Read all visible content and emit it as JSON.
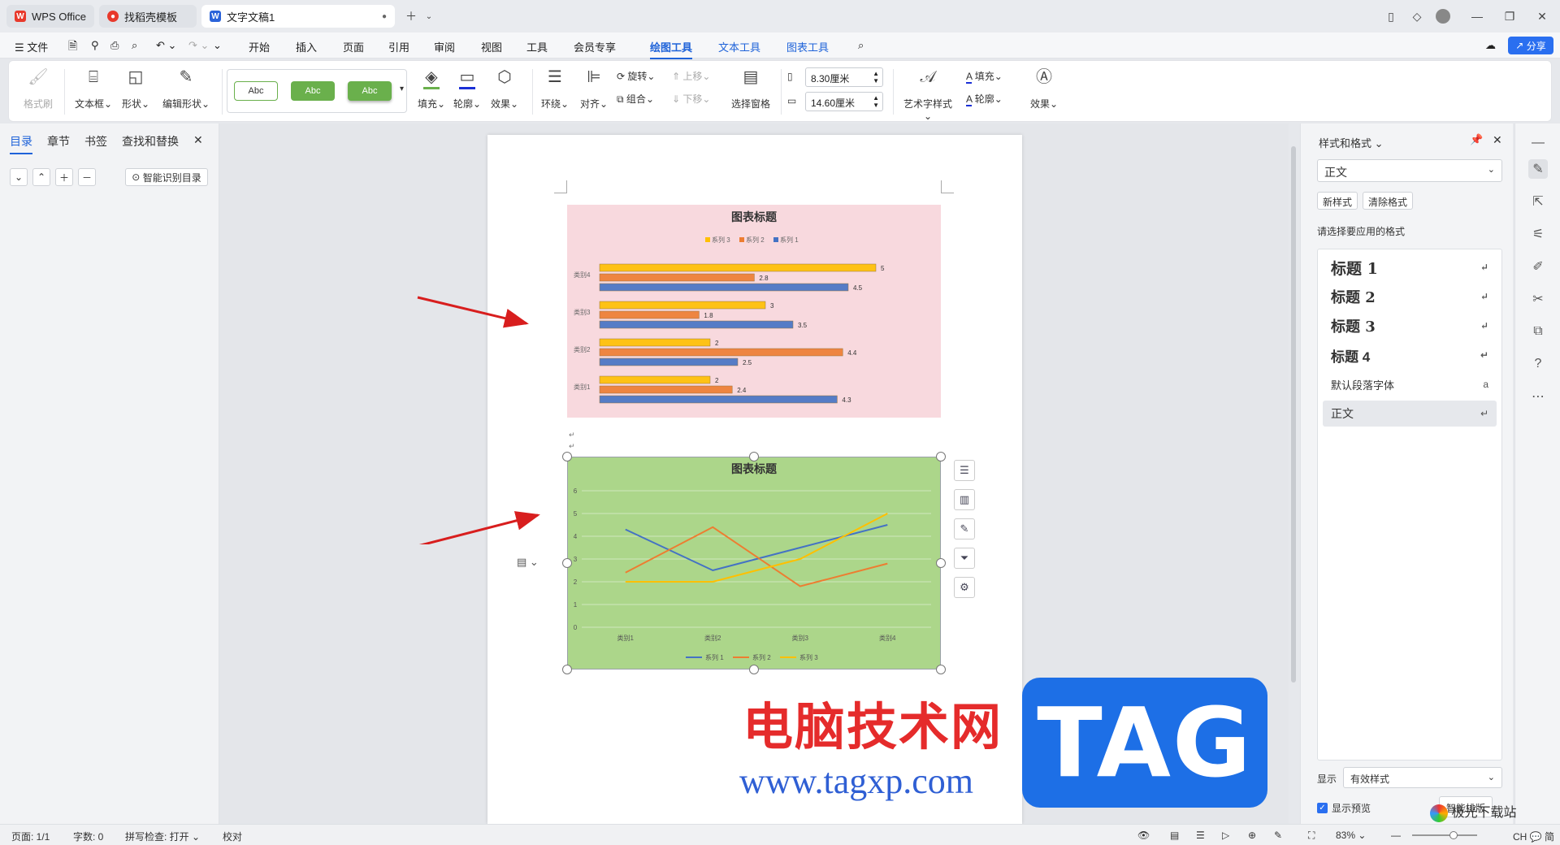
{
  "tabs": [
    {
      "label": "WPS Office",
      "icon": "wps-logo-icon"
    },
    {
      "label": "找稻壳模板",
      "icon": "daoke-icon"
    },
    {
      "label": "文字文稿1",
      "icon": "word-doc-icon"
    }
  ],
  "menu": {
    "file": "文件",
    "items": [
      "开始",
      "插入",
      "页面",
      "引用",
      "审阅",
      "视图",
      "工具",
      "会员专享"
    ],
    "contextual": [
      "绘图工具",
      "文本工具",
      "图表工具"
    ],
    "share": "分享"
  },
  "ribbon": {
    "format_painter": "格式刷",
    "textbox": "文本框",
    "shape": "形状",
    "edit_shape": "编辑形状",
    "style_abc": [
      "Abc",
      "Abc",
      "Abc"
    ],
    "fill": "填充",
    "outline": "轮廓",
    "effect": "效果",
    "wrap": "环绕",
    "align": "对齐",
    "rotate": "旋转",
    "group": "组合",
    "bring_up": "上移",
    "send_down": "下移",
    "selection_pane": "选择窗格",
    "height": "8.30厘米",
    "width": "14.60厘米",
    "art_style": "艺术字样式",
    "text_fill": "填充",
    "text_outline": "轮廓",
    "text_effect": "效果"
  },
  "left_panel": {
    "tabs": [
      "目录",
      "章节",
      "书签",
      "查找和替换"
    ],
    "smart_toc": "智能识别目录"
  },
  "right_panel": {
    "title": "样式和格式",
    "current_style": "正文",
    "new_style": "新样式",
    "clear_format": "清除格式",
    "prompt": "请选择要应用的格式",
    "styles": [
      "标题 1",
      "标题 2",
      "标题 3",
      "标题 4",
      "默认段落字体",
      "正文"
    ],
    "show_label": "显示",
    "show_value": "有效样式",
    "preview_label": "显示预览",
    "smart_layout": "智能排版"
  },
  "status": {
    "page": "页面: 1/1",
    "words": "字数: 0",
    "spell": "拼写检查: 打开",
    "proof": "校对",
    "zoom": "83%",
    "ime": "CH 💬 简"
  },
  "watermark": {
    "site_cn": "电脑技术网",
    "url": "www.tagxp.com",
    "tag": "TAG",
    "corner": "极光下载站"
  },
  "chart_data": [
    {
      "type": "bar",
      "title": "图表标题",
      "categories": [
        "类别1",
        "类别2",
        "类别3",
        "类别4"
      ],
      "series": [
        {
          "name": "系列 1",
          "values": [
            4.3,
            2.5,
            3.5,
            4.5
          ],
          "color": "#4472c4"
        },
        {
          "name": "系列 2",
          "values": [
            2.4,
            4.4,
            1.8,
            2.8
          ],
          "color": "#ed7d31"
        },
        {
          "name": "系列 3",
          "values": [
            2,
            2,
            3,
            5
          ],
          "color": "#ffc000"
        }
      ],
      "legend": [
        "系列 3",
        "系列 2",
        "系列 1"
      ],
      "background": "#f8d9de",
      "orientation": "horizontal"
    },
    {
      "type": "line",
      "title": "图表标题",
      "categories": [
        "类别1",
        "类别2",
        "类别3",
        "类别4"
      ],
      "ylim": [
        0,
        6
      ],
      "yticks": [
        "0",
        "1",
        "2",
        "3",
        "4",
        "5",
        "6"
      ],
      "series": [
        {
          "name": "系列 1",
          "values": [
            4.3,
            2.5,
            3.5,
            4.5
          ],
          "color": "#4472c4"
        },
        {
          "name": "系列 2",
          "values": [
            2.4,
            4.4,
            1.8,
            2.8
          ],
          "color": "#ed7d31"
        },
        {
          "name": "系列 3",
          "values": [
            2,
            2,
            3,
            5
          ],
          "color": "#ffc000"
        }
      ],
      "background": "#acd68a",
      "grid": true,
      "legend_position": "bottom"
    }
  ]
}
